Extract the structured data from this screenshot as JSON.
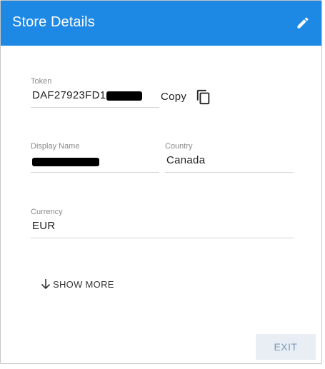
{
  "dialog": {
    "title": "Store Details"
  },
  "token": {
    "label": "Token",
    "value": "DAF27923FD1",
    "copy_label": "Copy"
  },
  "display_name": {
    "label": "Display Name"
  },
  "country": {
    "label": "Country",
    "value": "Canada"
  },
  "currency": {
    "label": "Currency",
    "value": "EUR"
  },
  "show_more": {
    "label": "SHOW MORE"
  },
  "footer": {
    "exit_label": "EXIT"
  },
  "colors": {
    "header": "#1e88e5",
    "exit_bg": "#e8eef4",
    "exit_text": "#7a9ab8"
  },
  "icons": [
    "pencil-icon",
    "copy-icon",
    "arrow-down-icon"
  ]
}
